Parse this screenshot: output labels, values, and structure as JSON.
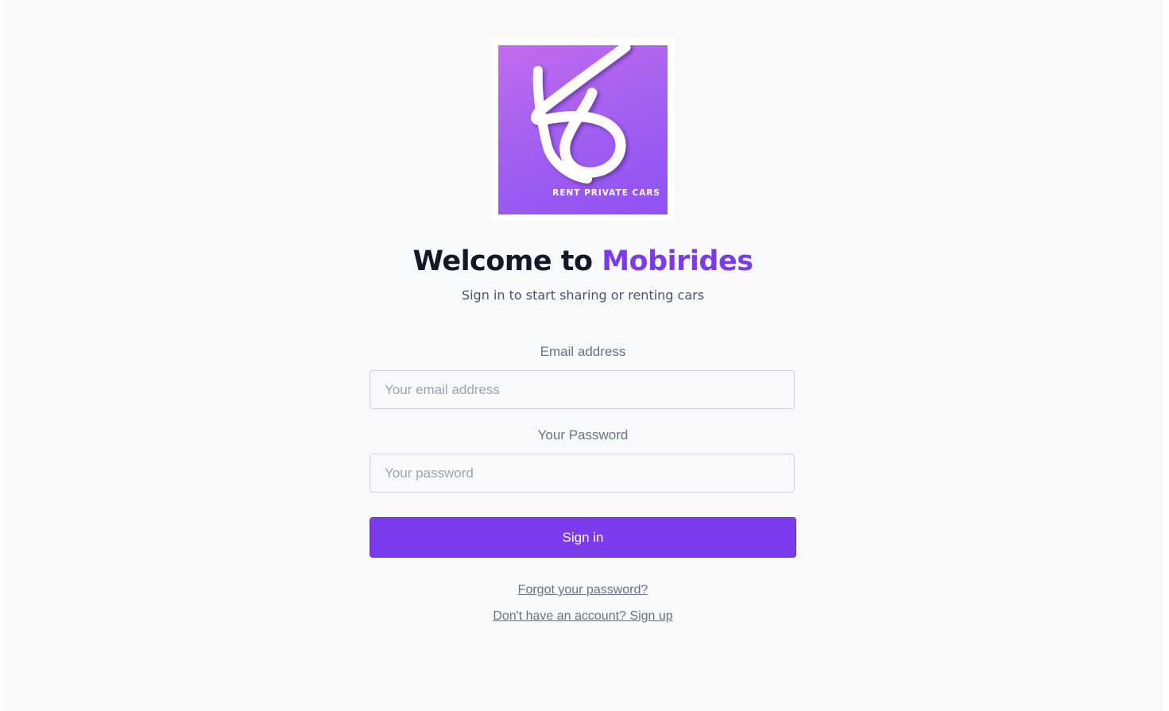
{
  "logo": {
    "tagline": "RENT PRIVATE CARS",
    "colors": {
      "gradient_start": "#c26bf0",
      "gradient_end": "#8f52f5",
      "mark": "#ffffff"
    }
  },
  "header": {
    "title_prefix": "Welcome to ",
    "title_brand": "Mobirides",
    "subtitle": "Sign in to start sharing or renting cars"
  },
  "form": {
    "email_label": "Email address",
    "email_placeholder": "Your email address",
    "email_value": "",
    "password_label": "Your Password",
    "password_placeholder": "Your password",
    "password_value": "",
    "submit_label": "Sign in"
  },
  "links": {
    "forgot_password": "Forgot your password?",
    "sign_up": "Don't have an account? Sign up"
  },
  "colors": {
    "accent": "#7c3aed",
    "background": "#f8f9fb",
    "title_text": "#111827",
    "muted_text": "#6b7280"
  }
}
